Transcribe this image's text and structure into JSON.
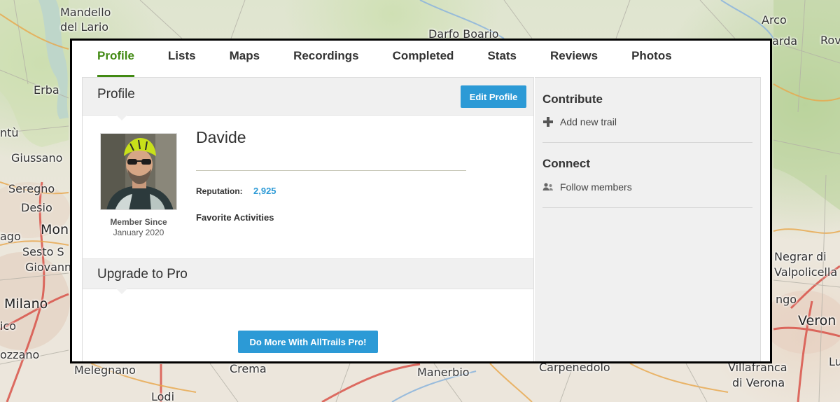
{
  "map": {
    "labels": [
      {
        "text": "Mandello",
        "cls": ""
      },
      {
        "text": "del Lario",
        "cls": ""
      },
      {
        "text": "Darfo Boario",
        "cls": ""
      },
      {
        "text": "Arco",
        "cls": ""
      },
      {
        "text": "arda",
        "cls": ""
      },
      {
        "text": "Rov",
        "cls": ""
      },
      {
        "text": "Erba",
        "cls": ""
      },
      {
        "text": "ntù",
        "cls": ""
      },
      {
        "text": "Giussano",
        "cls": ""
      },
      {
        "text": "Seregno",
        "cls": ""
      },
      {
        "text": "Desio",
        "cls": ""
      },
      {
        "text": "Mon",
        "cls": "big"
      },
      {
        "text": "ago",
        "cls": ""
      },
      {
        "text": "Sesto S",
        "cls": ""
      },
      {
        "text": "Giovann",
        "cls": ""
      },
      {
        "text": "Milano",
        "cls": "big"
      },
      {
        "text": "ico",
        "cls": ""
      },
      {
        "text": "ozzano",
        "cls": ""
      },
      {
        "text": "Melegnano",
        "cls": ""
      },
      {
        "text": "Crema",
        "cls": ""
      },
      {
        "text": "Lodi",
        "cls": ""
      },
      {
        "text": "Manerbio",
        "cls": ""
      },
      {
        "text": "Carpenedolo",
        "cls": ""
      },
      {
        "text": "Villafranca",
        "cls": ""
      },
      {
        "text": "di Verona",
        "cls": ""
      },
      {
        "text": "Negrar di",
        "cls": ""
      },
      {
        "text": "Valpolicella",
        "cls": ""
      },
      {
        "text": "ngo",
        "cls": ""
      },
      {
        "text": "Veron",
        "cls": "big"
      },
      {
        "text": "Lup",
        "cls": ""
      }
    ]
  },
  "tabs": [
    {
      "label": "Profile",
      "active": true
    },
    {
      "label": "Lists",
      "active": false
    },
    {
      "label": "Maps",
      "active": false
    },
    {
      "label": "Recordings",
      "active": false
    },
    {
      "label": "Completed",
      "active": false
    },
    {
      "label": "Stats",
      "active": false
    },
    {
      "label": "Reviews",
      "active": false
    },
    {
      "label": "Photos",
      "active": false
    }
  ],
  "profile": {
    "section_title": "Profile",
    "edit_button": "Edit Profile",
    "name": "Davide",
    "member_since_label": "Member Since",
    "member_since_date": "January 2020",
    "reputation_label": "Reputation:",
    "reputation_value": "2,925",
    "favorite_activities_label": "Favorite Activities"
  },
  "upgrade": {
    "section_title": "Upgrade to Pro",
    "pro_button": "Do More With AllTrails Pro!"
  },
  "sidebar": {
    "contribute_title": "Contribute",
    "add_trail": "Add new trail",
    "add_icon": "plus-icon",
    "connect_title": "Connect",
    "follow_members": "Follow members",
    "follow_icon": "people-icon"
  },
  "colors": {
    "accent_green": "#428a13",
    "button_blue": "#2c9ad6"
  }
}
